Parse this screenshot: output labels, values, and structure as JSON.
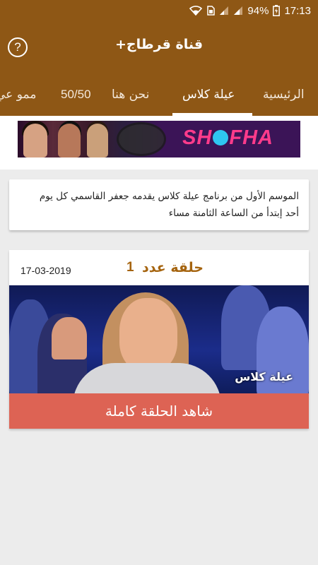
{
  "status_bar": {
    "battery": "94%",
    "time": "17:13"
  },
  "app_bar": {
    "title": "قناة قرطاج+"
  },
  "tabs": [
    {
      "label": "الرئيسية"
    },
    {
      "label": "عيلة كلاس"
    },
    {
      "label": "نحن هنا"
    },
    {
      "label": "50/50"
    },
    {
      "label": "ممو عي"
    }
  ],
  "banner": {
    "logo_text": "SH",
    "logo_text_end": "FHA"
  },
  "description": {
    "line1": "الموسم الأول من برنامج عيلة كلاس يقدمه جعفر القاسمي كل يوم",
    "line2": "أحد إبتدأ من الساعة الثامنة مساء"
  },
  "episode": {
    "title": "حلقة عدد",
    "number": "1",
    "date": "17-03-2019",
    "thumb_logo": "عيلة كلاس",
    "watch_label": "شاهد الحلقة كاملة"
  },
  "colors": {
    "primary": "#8e5715",
    "accent_text": "#a5640f",
    "watch_button": "#dd6354"
  }
}
